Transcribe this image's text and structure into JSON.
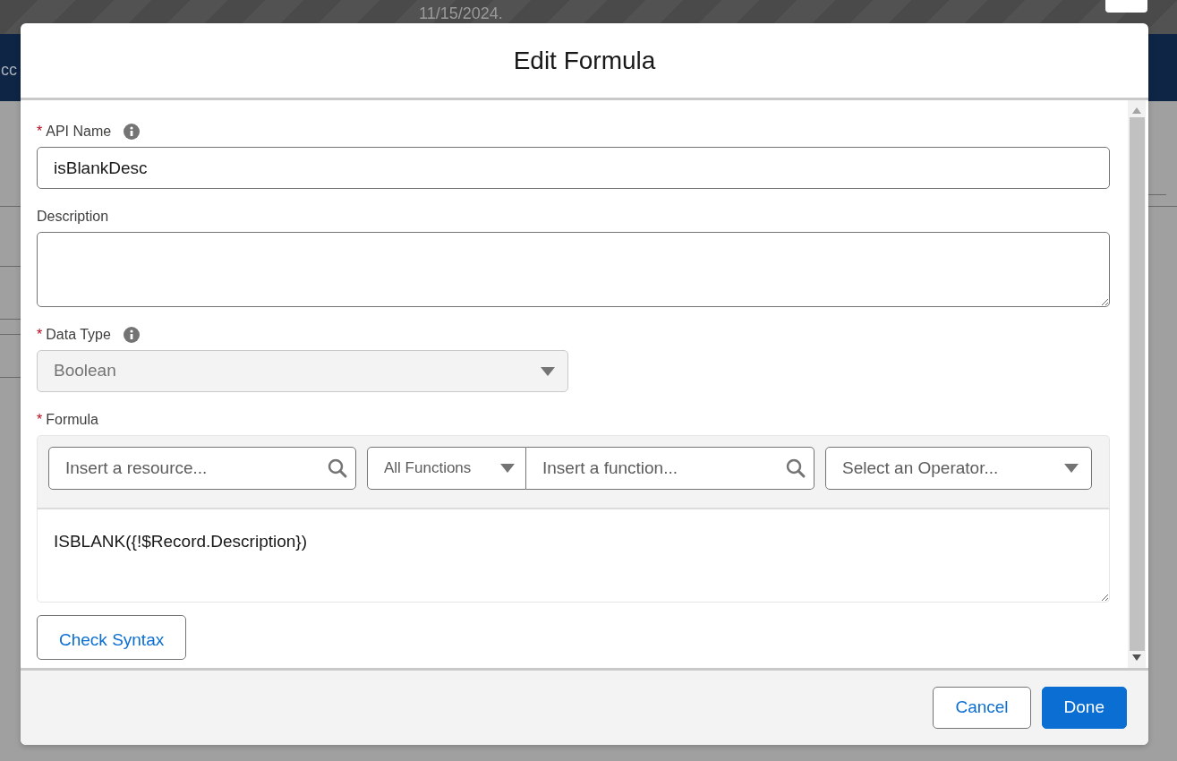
{
  "backdrop": {
    "toast_text": "11/15/2024.",
    "app_text": "cc"
  },
  "modal": {
    "title": "Edit Formula",
    "fields": [
      {
        "kind": "input",
        "label": "API Name",
        "required_mark": "*",
        "info": true,
        "value": "isBlankDesc"
      },
      {
        "kind": "textarea",
        "label": "Description",
        "info": false
      },
      {
        "kind": "select",
        "label": "Data Type",
        "required_mark": "*",
        "info": true,
        "value": "Boolean",
        "disabled": true
      },
      {
        "kind": "formula",
        "label": "Formula",
        "required_mark": "*",
        "info": false,
        "resource_placeholder": "Insert a resource...",
        "function_category": "All Functions",
        "function_placeholder": "Insert a function...",
        "operator_placeholder": "Select an Operator...",
        "value": "ISBLANK({!$Record.Description})"
      }
    ],
    "check_button": "Check Syntax",
    "buttons": [
      {
        "label": "Cancel",
        "kind": "neutral"
      },
      {
        "label": "Done",
        "kind": "brand"
      }
    ]
  }
}
